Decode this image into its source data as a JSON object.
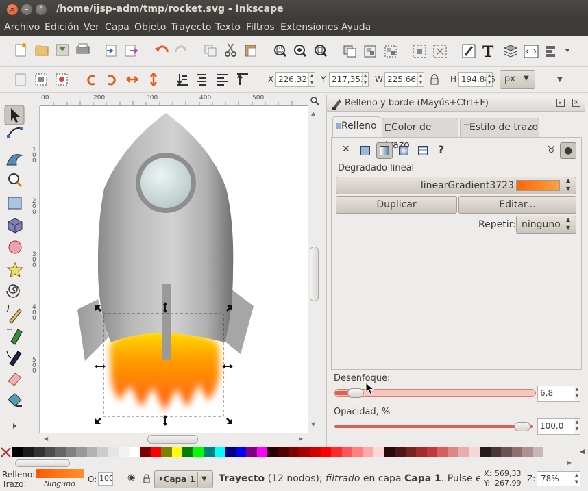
{
  "window": {
    "title": "/home/ijsp-adm/tmp/rocket.svg - Inkscape"
  },
  "menu": [
    "Archivo",
    "Edición",
    "Ver",
    "Capa",
    "Objeto",
    "Trayecto",
    "Texto",
    "Filtros",
    "Extensiones",
    "Ayuda"
  ],
  "controls": {
    "x_label": "X",
    "x_value": "226,329",
    "y_label": "Y",
    "y_value": "217,353",
    "w_label": "W",
    "w_value": "225,660",
    "h_label": "H",
    "h_value": "194,886",
    "unit": "px"
  },
  "rulers": {
    "top": [
      "00",
      "200",
      "300",
      "400",
      "500"
    ],
    "left": [
      "1 0 0",
      "2 0 0",
      "3 0 0",
      "4 0 0",
      "5 0 0"
    ]
  },
  "panel": {
    "title": "Relleno y borde (Mayús+Ctrl+F)",
    "tabs": [
      "Relleno",
      "Color de trazo",
      "Estilo de trazo"
    ],
    "help_glyph": "?",
    "gradient_label": "Degradado lineal",
    "gradient_name": "linearGradient3723",
    "duplicate_label": "Duplicar",
    "edit_label": "Editar...",
    "repeat_label": "Repetir:",
    "repeat_value": "ninguno",
    "blur_label": "Desenfoque:",
    "blur_value": "6,8",
    "opacity_label": "Opacidad, %",
    "opacity_value": "100,0"
  },
  "status": {
    "fill_label": "Relleno:",
    "fill_value": "L",
    "stroke_label": "Trazo:",
    "stroke_value": "Ninguno",
    "o_label": "O:",
    "o_value": "100",
    "layer": "•Capa 1",
    "message_bold": "Trayecto",
    "message_rest": " (12 nodos); ",
    "message_italic": "filtrado",
    "message_tail": " en capa ",
    "message_layer": "Capa 1",
    "message_end": ". Pulse en la",
    "cursor_x_label": "X:",
    "cursor_x": "569,33",
    "cursor_y_label": "Y:",
    "cursor_y": "267,99",
    "zoom_label": "Z:",
    "zoom": "78%"
  },
  "palette": [
    "#000000",
    "#1a1a1a",
    "#333333",
    "#4d4d4d",
    "#666666",
    "#808080",
    "#999999",
    "#b3b3b3",
    "#cccccc",
    "#e6e6e6",
    "#f2f2f2",
    "#ffffff",
    "#800000",
    "#ff0000",
    "#808000",
    "#ffff00",
    "#008000",
    "#00ff00",
    "#008080",
    "#00ffff",
    "#000080",
    "#0000ff",
    "#800080",
    "#ff00ff",
    "#2b0000",
    "#550000",
    "#800000",
    "#aa0000",
    "#d40000",
    "#ff0000",
    "#ff2a2a",
    "#ff5555",
    "#ff8080",
    "#ffaaaa",
    "#ffd5d5",
    "#280b0b",
    "#501616",
    "#782121",
    "#a02c2c",
    "#c83737",
    "#d35f5f",
    "#de8787",
    "#e9afaf",
    "#f4d7d7",
    "#241c1c",
    "#483737",
    "#6c5353",
    "#916f6f",
    "#ac9393",
    "#c8b7b7"
  ],
  "colors": {
    "accent_orange": "#ff6600",
    "title_bg": "#3c3b37"
  }
}
